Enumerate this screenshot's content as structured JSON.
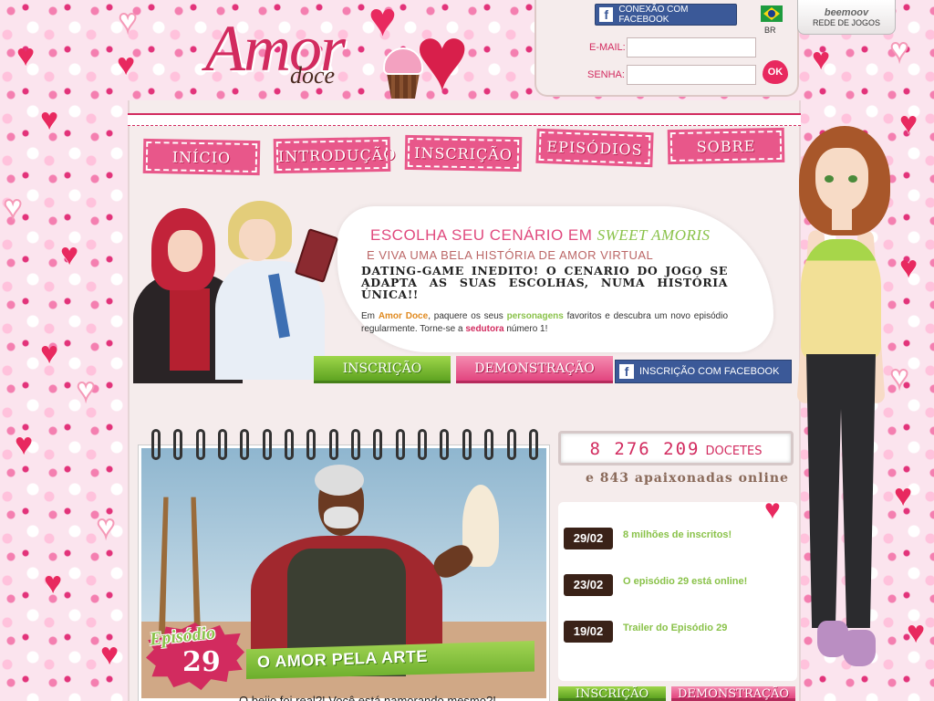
{
  "brand": {
    "logo_word1": "Amor",
    "logo_word2": "doce"
  },
  "login": {
    "facebook_label": "CONEXÃO COM FACEBOOK",
    "lang_code": "BR",
    "email_label": "E-MAIL:",
    "password_label": "SENHA:",
    "ok_label": "OK"
  },
  "beemoov": {
    "name": "beemoov",
    "label": "REDE DE JOGOS"
  },
  "nav": [
    {
      "label": "INÍCIO"
    },
    {
      "label": "INTRODUÇÃO"
    },
    {
      "label": "INSCRIÇÃO"
    },
    {
      "label": "EPISÓDIOS"
    },
    {
      "label": "SOBRE"
    }
  ],
  "hero": {
    "title_prefix": "ESCOLHA SEU CENÁRIO EM",
    "title_game": "SWEET AMORIS",
    "subtitle": "E VIVA UMA BELA HISTÓRIA DE AMOR VIRTUAL",
    "headline": "DATING-GAME INEDITO! O CENARIO DO JOGO SE ADAPTA AS SUAS ESCOLHAS, NUMA HISTÓRIA ÚNICA!!",
    "body_1": "Em",
    "body_hl1": "Amor Doce",
    "body_2": ", paquere os seus",
    "body_hl2": "personagens",
    "body_3": "favoritos e descubra um novo episódio regularmente. Torne-se a",
    "body_hl3": "sedutora",
    "body_4": "número 1!"
  },
  "cta": {
    "signup": "INSCRIÇÃO",
    "demo": "DEMONSTRAÇÃO",
    "facebook": "INSCRIÇÃO COM FACEBOOK"
  },
  "episode": {
    "word": "Episódio",
    "number": "29",
    "title": "O AMOR PELA ARTE",
    "caption": "O beijo foi real?! Você está namorando mesmo?!"
  },
  "stats": {
    "count": "8 276 209",
    "unit": "DOCETES",
    "online": "e 843 apaixonadas online"
  },
  "news": [
    {
      "date": "29/02",
      "text": "8 milhões de inscritos!"
    },
    {
      "date": "23/02",
      "text": "O episódio 29 está online!"
    },
    {
      "date": "19/02",
      "text": "Trailer do Episódio 29"
    }
  ],
  "bottom_cta": {
    "signup": "INSCRIÇÃO",
    "demo": "DEMONSTRAÇÃO"
  },
  "colors": {
    "accent": "#d22b5f",
    "green": "#8ac24a",
    "facebook": "#3b5998"
  }
}
